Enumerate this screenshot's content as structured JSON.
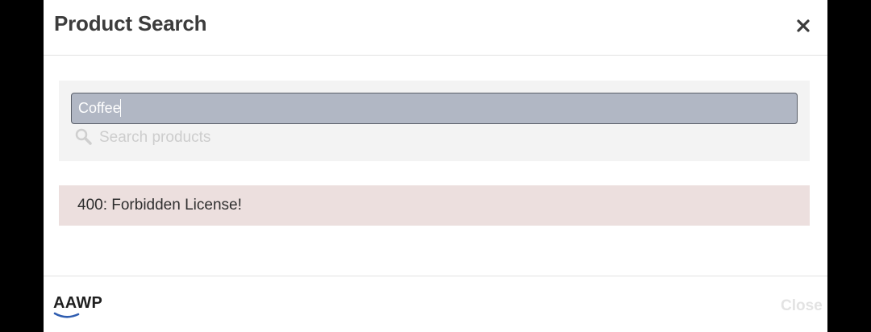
{
  "modal": {
    "title": "Product Search",
    "close_icon": "close-icon"
  },
  "search": {
    "value": "Coffee",
    "placeholder": "Search products",
    "icon": "search-icon"
  },
  "error": {
    "message": "400: Forbidden License!"
  },
  "footer": {
    "logo_text": "AAWP",
    "close_label": "Close"
  },
  "colors": {
    "input_bg": "#b1b7c4",
    "error_bg": "#ecdfde",
    "panel_bg": "#f3f3f3",
    "logo_accent": "#2f5db0"
  }
}
